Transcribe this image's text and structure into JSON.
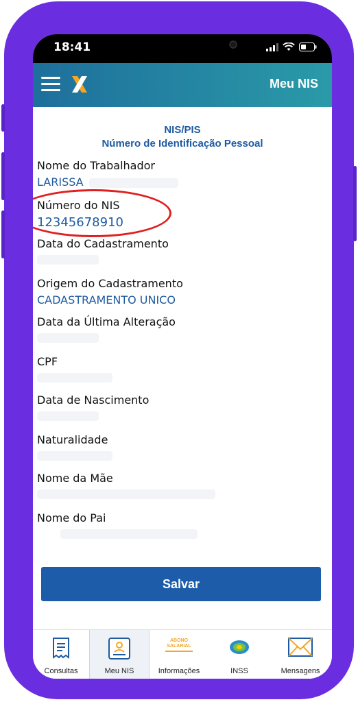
{
  "status": {
    "time": "18:41"
  },
  "appbar": {
    "title": "Meu NIS"
  },
  "heading": {
    "line1": "NIS/PIS",
    "line2": "Número de Identificação Pessoal"
  },
  "fields": {
    "trabalhador": {
      "label": "Nome do Trabalhador",
      "value": "LARISSA"
    },
    "nis": {
      "label": "Número do NIS",
      "value": "12345678910"
    },
    "data_cadastro": {
      "label": "Data do Cadastramento"
    },
    "origem": {
      "label": "Origem do Cadastramento",
      "value": "CADASTRAMENTO UNICO"
    },
    "ultima_alteracao": {
      "label": "Data da Última Alteração"
    },
    "cpf": {
      "label": "CPF"
    },
    "nascimento": {
      "label": "Data de Nascimento"
    },
    "naturalidade": {
      "label": "Naturalidade"
    },
    "mae": {
      "label": "Nome da Mãe"
    },
    "pai": {
      "label": "Nome do Pai"
    }
  },
  "actions": {
    "save_label": "Salvar"
  },
  "tabs": [
    {
      "label": "Consultas",
      "icon": "receipt-icon"
    },
    {
      "label": "Meu NIS",
      "icon": "id-card-icon",
      "active": true
    },
    {
      "label": "Informações",
      "icon": "abono-salarial-icon",
      "badge": "ABONO SALARIAL"
    },
    {
      "label": "INSS",
      "icon": "inss-icon"
    },
    {
      "label": "Mensagens",
      "icon": "envelope-icon"
    }
  ],
  "colors": {
    "frame": "#6a2ee0",
    "accent": "#1d5ca8",
    "highlight": "#e02020"
  }
}
